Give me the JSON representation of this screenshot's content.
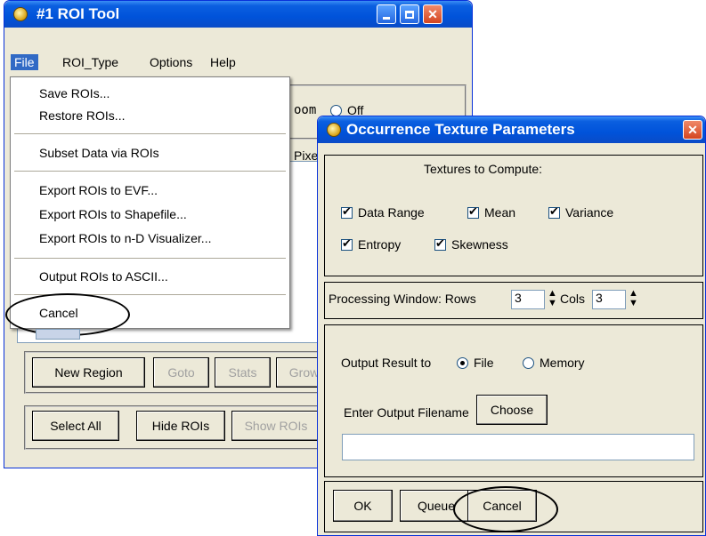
{
  "roi_window": {
    "title": "#1 ROI Tool",
    "menubar": [
      "File",
      "ROI_Type",
      "Options",
      "Help"
    ],
    "zoom_label_fragment": "oom",
    "off_label": "Off",
    "pixel_fragment": "Pixe",
    "buttons_row1": {
      "new_region": "New Region",
      "goto": "Goto",
      "stats": "Stats",
      "grow": "Grow"
    },
    "buttons_row2": {
      "select_all": "Select All",
      "hide_rois": "Hide ROIs",
      "show_rois": "Show ROIs"
    }
  },
  "file_menu": {
    "items": {
      "save": "Save ROIs...",
      "restore": "Restore ROIs...",
      "subset": "Subset Data via ROIs",
      "export_evf": "Export ROIs to EVF...",
      "export_shp": "Export ROIs to Shapefile...",
      "export_nd": "Export ROIs to n-D Visualizer...",
      "output_ascii": "Output ROIs to ASCII...",
      "cancel": "Cancel"
    }
  },
  "texture_dialog": {
    "title": "Occurrence Texture Parameters",
    "textures_heading": "Textures to Compute:",
    "checkboxes": {
      "data_range": "Data Range",
      "mean": "Mean",
      "variance": "Variance",
      "entropy": "Entropy",
      "skewness": "Skewness"
    },
    "processing_window_label": "Processing Window: Rows",
    "rows_value": "3",
    "cols_label": "Cols",
    "cols_value": "3",
    "output_result_label": "Output Result to",
    "output_file": "File",
    "output_memory": "Memory",
    "filename_label": "Enter Output Filename",
    "choose_button": "Choose",
    "filename_value": "",
    "ok_button": "OK",
    "queue_button": "Queue",
    "cancel_button": "Cancel"
  }
}
